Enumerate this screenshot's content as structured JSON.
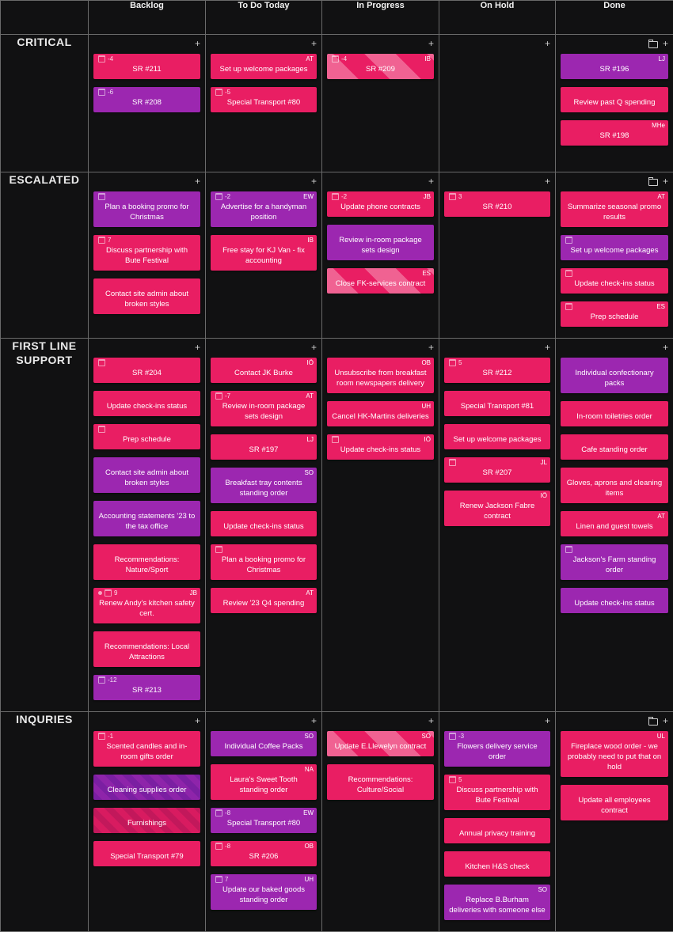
{
  "columns": [
    "Backlog",
    "To Do Today",
    "In Progress",
    "On Hold",
    "Done"
  ],
  "icons": {
    "add": "+",
    "folder": "folder-icon",
    "calendar": "calendar-icon",
    "pin": "pin-icon"
  },
  "colors": {
    "pink": "#e91e63",
    "purple": "#9c27b0",
    "stripe_pink": "#f06292",
    "background": "#111112",
    "grid_line": "#6a6a6a"
  },
  "lanes": [
    {
      "name": "CRITICAL",
      "cells": [
        {
          "cards": [
            {
              "title": "SR #211",
              "color": "pink",
              "calendar": true,
              "due": "-4"
            },
            {
              "title": "SR #208",
              "color": "purple",
              "calendar": true,
              "due": "-6"
            }
          ]
        },
        {
          "cards": [
            {
              "title": "Set up welcome packages",
              "color": "pink",
              "assignee": "AT"
            },
            {
              "title": "Special Transport #80",
              "color": "pink",
              "calendar": true,
              "due": "-5"
            }
          ]
        },
        {
          "cards": [
            {
              "title": "SR #209",
              "color": "striped-pink",
              "calendar": true,
              "due": "-4",
              "assignee": "IB"
            }
          ]
        },
        {
          "cards": []
        },
        {
          "folder": true,
          "cards": [
            {
              "title": "SR #196",
              "color": "purple",
              "assignee": "LJ"
            },
            {
              "title": "Review past Q spending",
              "color": "pink"
            },
            {
              "title": "SR #198",
              "color": "pink",
              "assignee": "MHe"
            }
          ]
        }
      ]
    },
    {
      "name": "ESCALATED",
      "cells": [
        {
          "cards": [
            {
              "title": "Plan a booking promo for Christmas",
              "color": "purple",
              "calendar": true
            },
            {
              "title": "Discuss partnership with Bute Festival",
              "color": "pink",
              "calendar": true,
              "due": "7"
            },
            {
              "title": "Contact site admin about broken styles",
              "color": "pink"
            }
          ]
        },
        {
          "cards": [
            {
              "title": "Advertise for a handyman position",
              "color": "purple",
              "calendar": true,
              "due": "-2",
              "assignee": "EW"
            },
            {
              "title": "Free stay for KJ Van - fix accounting",
              "color": "pink",
              "assignee": "IB"
            }
          ]
        },
        {
          "cards": [
            {
              "title": "Update phone contracts",
              "color": "pink",
              "calendar": true,
              "due": "-2",
              "assignee": "JB"
            },
            {
              "title": "Review in-room package sets design",
              "color": "purple"
            },
            {
              "title": "Close FK-services contract",
              "color": "striped-pink",
              "assignee": "ES"
            }
          ]
        },
        {
          "cards": [
            {
              "title": "SR #210",
              "color": "pink",
              "calendar": true,
              "due": "3"
            }
          ]
        },
        {
          "folder": true,
          "cards": [
            {
              "title": "Summarize seasonal promo results",
              "color": "pink",
              "assignee": "AT"
            },
            {
              "title": "Set up welcome packages",
              "color": "purple",
              "calendar": true
            },
            {
              "title": "Update check-ins status",
              "color": "pink",
              "calendar": true
            },
            {
              "title": "Prep schedule",
              "color": "pink",
              "calendar": true,
              "assignee": "ES"
            }
          ]
        }
      ]
    },
    {
      "name": "FIRST LINE SUPPORT",
      "cells": [
        {
          "cards": [
            {
              "title": "SR #204",
              "color": "pink",
              "calendar": true
            },
            {
              "title": "Update check-ins status",
              "color": "pink"
            },
            {
              "title": "Prep schedule",
              "color": "pink",
              "calendar": true
            },
            {
              "title": "Contact site admin about broken styles",
              "color": "purple"
            },
            {
              "title": "Accounting statements '23 to the tax office",
              "color": "purple"
            },
            {
              "title": "Recommendations: Nature/Sport",
              "color": "pink"
            },
            {
              "title": "Renew Andy's kitchen safety cert.",
              "color": "pink",
              "pin": true,
              "calendar": true,
              "due": "9",
              "assignee": "JB"
            },
            {
              "title": "Recommendations: Local Attractions",
              "color": "pink"
            },
            {
              "title": "SR #213",
              "color": "purple",
              "calendar": true,
              "due": "-12"
            }
          ]
        },
        {
          "cards": [
            {
              "title": "Contact JK Burke",
              "color": "pink",
              "assignee": "IÖ"
            },
            {
              "title": "Review in-room package sets design",
              "color": "pink",
              "calendar": true,
              "due": "-7",
              "assignee": "AT"
            },
            {
              "title": "SR #197",
              "color": "pink",
              "assignee": "LJ"
            },
            {
              "title": "Breakfast tray contents standing order",
              "color": "purple",
              "assignee": "SO"
            },
            {
              "title": "Update check-ins status",
              "color": "pink"
            },
            {
              "title": "Plan a booking promo for Christmas",
              "color": "pink",
              "calendar": true
            },
            {
              "title": "Review '23 Q4 spending",
              "color": "pink",
              "assignee": "AT"
            }
          ]
        },
        {
          "cards": [
            {
              "title": "Unsubscribe from breakfast room newspapers delivery",
              "color": "pink",
              "assignee": "OB"
            },
            {
              "title": "Cancel HK-Martins deliveries",
              "color": "pink",
              "assignee": "UH"
            },
            {
              "title": "Update check-ins status",
              "color": "pink",
              "calendar": true,
              "assignee": "IÖ"
            }
          ]
        },
        {
          "cards": [
            {
              "title": "SR #212",
              "color": "pink",
              "calendar": true,
              "due": "5"
            },
            {
              "title": "Special Transport #81",
              "color": "pink"
            },
            {
              "title": "Set up welcome packages",
              "color": "pink"
            },
            {
              "title": "SR #207",
              "color": "pink",
              "calendar": true,
              "assignee": "JL"
            },
            {
              "title": "Renew Jackson Fabre contract",
              "color": "pink",
              "assignee": "IÖ"
            }
          ]
        },
        {
          "cards": [
            {
              "title": "Individual confectionary packs",
              "color": "purple"
            },
            {
              "title": "In-room toiletries order",
              "color": "pink"
            },
            {
              "title": "Cafe standing order",
              "color": "pink"
            },
            {
              "title": "Gloves, aprons and cleaning items",
              "color": "pink"
            },
            {
              "title": "Linen and guest towels",
              "color": "pink",
              "assignee": "AT"
            },
            {
              "title": "Jackson's Farm standing order",
              "color": "purple",
              "calendar": true
            },
            {
              "title": "Update check-ins status",
              "color": "purple"
            }
          ]
        }
      ]
    },
    {
      "name": "INQURIES",
      "cells": [
        {
          "cards": [
            {
              "title": "Scented candles and in-room gifts order",
              "color": "pink",
              "calendar": true,
              "due": "-1"
            },
            {
              "title": "Cleaning supplies order",
              "color": "striped-purple"
            },
            {
              "title": "Furnishings",
              "color": "striped-darkpink"
            },
            {
              "title": "Special Transport #79",
              "color": "pink"
            }
          ]
        },
        {
          "cards": [
            {
              "title": "Individual Coffee Packs",
              "color": "purple",
              "assignee": "SO"
            },
            {
              "title": "Laura's Sweet Tooth standing order",
              "color": "pink",
              "assignee": "NA"
            },
            {
              "title": "Special Transport #80",
              "color": "purple",
              "calendar": true,
              "due": "-8",
              "assignee": "EW"
            },
            {
              "title": "SR #206",
              "color": "pink",
              "calendar": true,
              "due": "-8",
              "assignee": "OB"
            },
            {
              "title": "Update our baked goods standing order",
              "color": "purple",
              "calendar": true,
              "due": "7",
              "assignee": "UH"
            }
          ]
        },
        {
          "cards": [
            {
              "title": "Update E.Llewelyn contract",
              "color": "striped-pink",
              "assignee": "SO"
            },
            {
              "title": "Recommendations: Culture/Social",
              "color": "pink"
            }
          ]
        },
        {
          "cards": [
            {
              "title": "Flowers delivery service order",
              "color": "purple",
              "calendar": true,
              "due": "-3"
            },
            {
              "title": "Discuss partnership with Bute Festival",
              "color": "pink",
              "calendar": true,
              "due": "5"
            },
            {
              "title": "Annual privacy training",
              "color": "pink"
            },
            {
              "title": "Kitchen H&S check",
              "color": "pink"
            },
            {
              "title": "Replace B.Burham deliveries with someone else",
              "color": "purple",
              "assignee": "SO"
            }
          ]
        },
        {
          "folder": true,
          "cards": [
            {
              "title": "Fireplace wood order - we probably need to put that on hold",
              "color": "pink",
              "assignee": "UL"
            },
            {
              "title": "Update all employees contract",
              "color": "pink"
            }
          ]
        }
      ]
    }
  ]
}
